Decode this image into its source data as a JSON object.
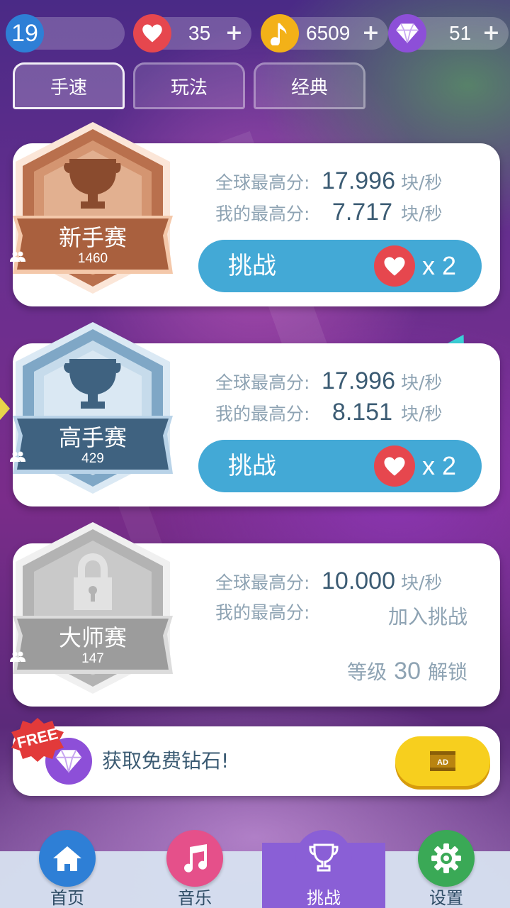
{
  "currency": {
    "level": "19",
    "hearts": "35",
    "notes": "6509",
    "gems": "51",
    "plus": "+"
  },
  "tabs": [
    {
      "label": "手速",
      "active": true
    },
    {
      "label": "玩法",
      "active": false
    },
    {
      "label": "经典",
      "active": false
    }
  ],
  "contests": [
    {
      "name": "新手赛",
      "players": "1460",
      "global_label": "全球最高分:",
      "global_value": "17.996",
      "my_label": "我的最高分:",
      "my_value": "7.717",
      "unit": "块/秒",
      "button": "挑战",
      "cost": "x 2",
      "color": "#b9704d"
    },
    {
      "name": "高手赛",
      "players": "429",
      "global_label": "全球最高分:",
      "global_value": "17.996",
      "my_label": "我的最高分:",
      "my_value": "8.151",
      "unit": "块/秒",
      "button": "挑战",
      "cost": "x 2",
      "color": "#5e8cb0"
    },
    {
      "name": "大师赛",
      "players": "147",
      "global_label": "全球最高分:",
      "global_value": "10.000",
      "my_label": "我的最高分:",
      "join_text": "加入挑战",
      "unit": "块/秒",
      "unlock_prefix": "等级",
      "unlock_level": "30",
      "unlock_suffix": "解锁",
      "color": "#a9a9a9"
    }
  ],
  "banner": {
    "free_tag": "FREE",
    "text": "获取免费钻石!",
    "ad_label": "AD"
  },
  "nav": [
    {
      "label": "首页",
      "icon": "home-icon"
    },
    {
      "label": "音乐",
      "icon": "music-note-icon"
    },
    {
      "label": "挑战",
      "icon": "trophy-icon",
      "active": true
    },
    {
      "label": "设置",
      "icon": "gear-icon"
    }
  ]
}
